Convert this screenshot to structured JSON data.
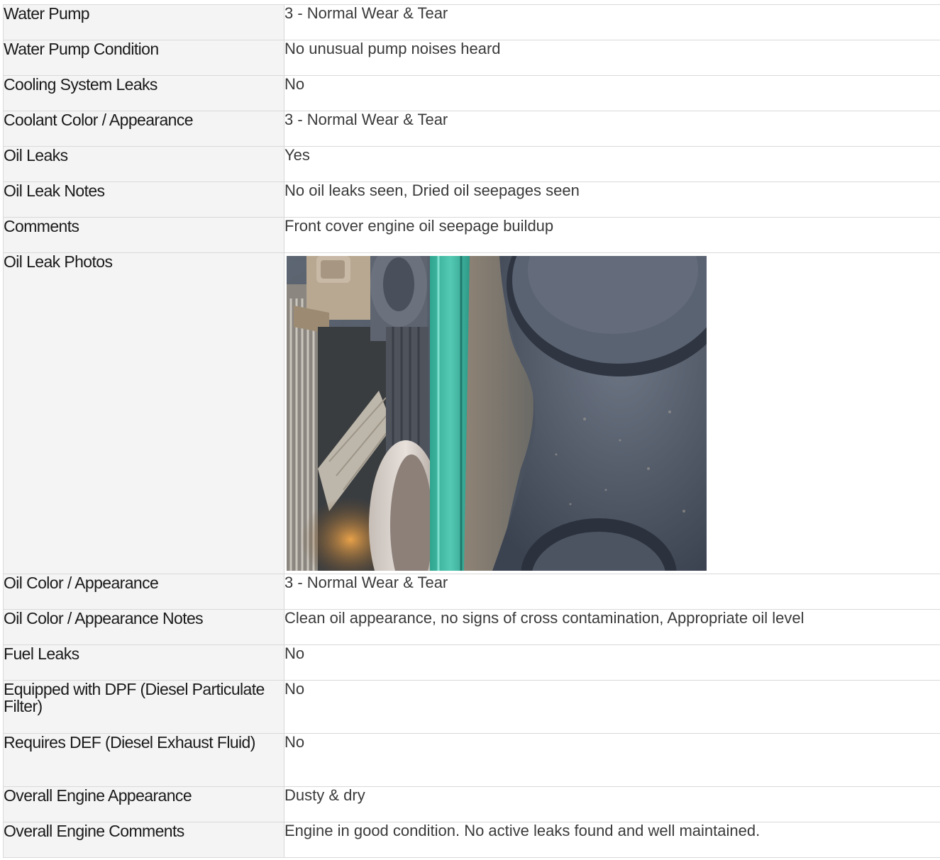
{
  "rows": [
    {
      "label": "Water Pump",
      "value": "3 - Normal Wear & Tear"
    },
    {
      "label": "Water Pump Condition",
      "value": "No unusual pump noises heard"
    },
    {
      "label": "Cooling System Leaks",
      "value": "No"
    },
    {
      "label": "Coolant Color / Appearance",
      "value": "3 - Normal Wear & Tear"
    },
    {
      "label": "Oil Leaks",
      "value": "Yes"
    },
    {
      "label": "Oil Leak Notes",
      "value": "No oil leaks seen, Dried oil seepages seen"
    },
    {
      "label": "Comments",
      "value": "Front cover engine oil seepage buildup"
    },
    {
      "label": "Oil Leak Photos",
      "photo": "engine-front-cover-oil-seepage-photo"
    },
    {
      "label": "Oil Color / Appearance",
      "value": "3 - Normal Wear & Tear"
    },
    {
      "label": "Oil Color / Appearance Notes",
      "value": "Clean oil appearance, no signs of cross contamination, Appropriate oil level"
    },
    {
      "label": "Fuel Leaks",
      "value": "No"
    },
    {
      "label": "Equipped with DPF (Diesel Particulate Filter)",
      "value": "No"
    },
    {
      "label": "Requires DEF (Diesel Exhaust Fluid)",
      "value": "No"
    },
    {
      "label": "Overall Engine Appearance",
      "value": "Dusty & dry"
    },
    {
      "label": "Overall Engine Comments",
      "value": "Engine in good condition. No active leaks found and well maintained."
    }
  ]
}
